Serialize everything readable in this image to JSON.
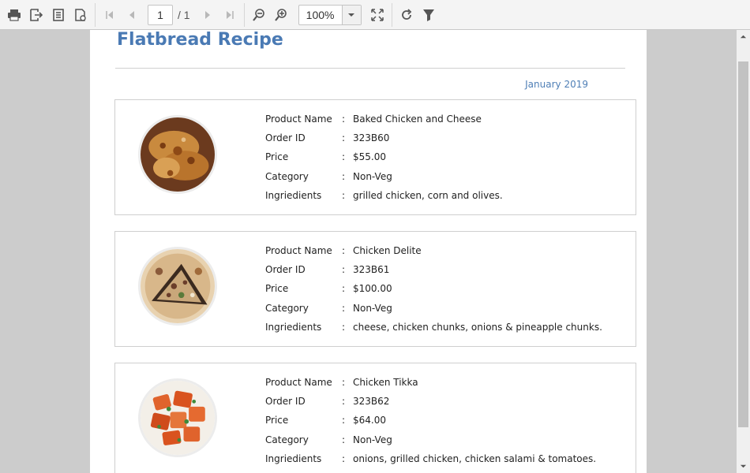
{
  "toolbar": {
    "page_number": "1",
    "page_total": "/ 1",
    "zoom": "100%"
  },
  "report": {
    "title": "Flatbread Recipe",
    "date": "January 2019",
    "labels": {
      "product_name": "Product Name",
      "order_id": "Order ID",
      "price": "Price",
      "category": "Category",
      "ingredients": "Ingriedients",
      "colon": ":"
    },
    "items": [
      {
        "product_name": "Baked Chicken and Cheese",
        "order_id": "323B60",
        "price": "$55.00",
        "category": "Non-Veg",
        "ingredients": "grilled chicken, corn and olives."
      },
      {
        "product_name": "Chicken Delite",
        "order_id": "323B61",
        "price": "$100.00",
        "category": "Non-Veg",
        "ingredients": "cheese, chicken chunks, onions & pineapple chunks."
      },
      {
        "product_name": "Chicken Tikka",
        "order_id": "323B62",
        "price": "$64.00",
        "category": "Non-Veg",
        "ingredients": "onions, grilled chicken, chicken salami & tomatoes."
      }
    ]
  }
}
